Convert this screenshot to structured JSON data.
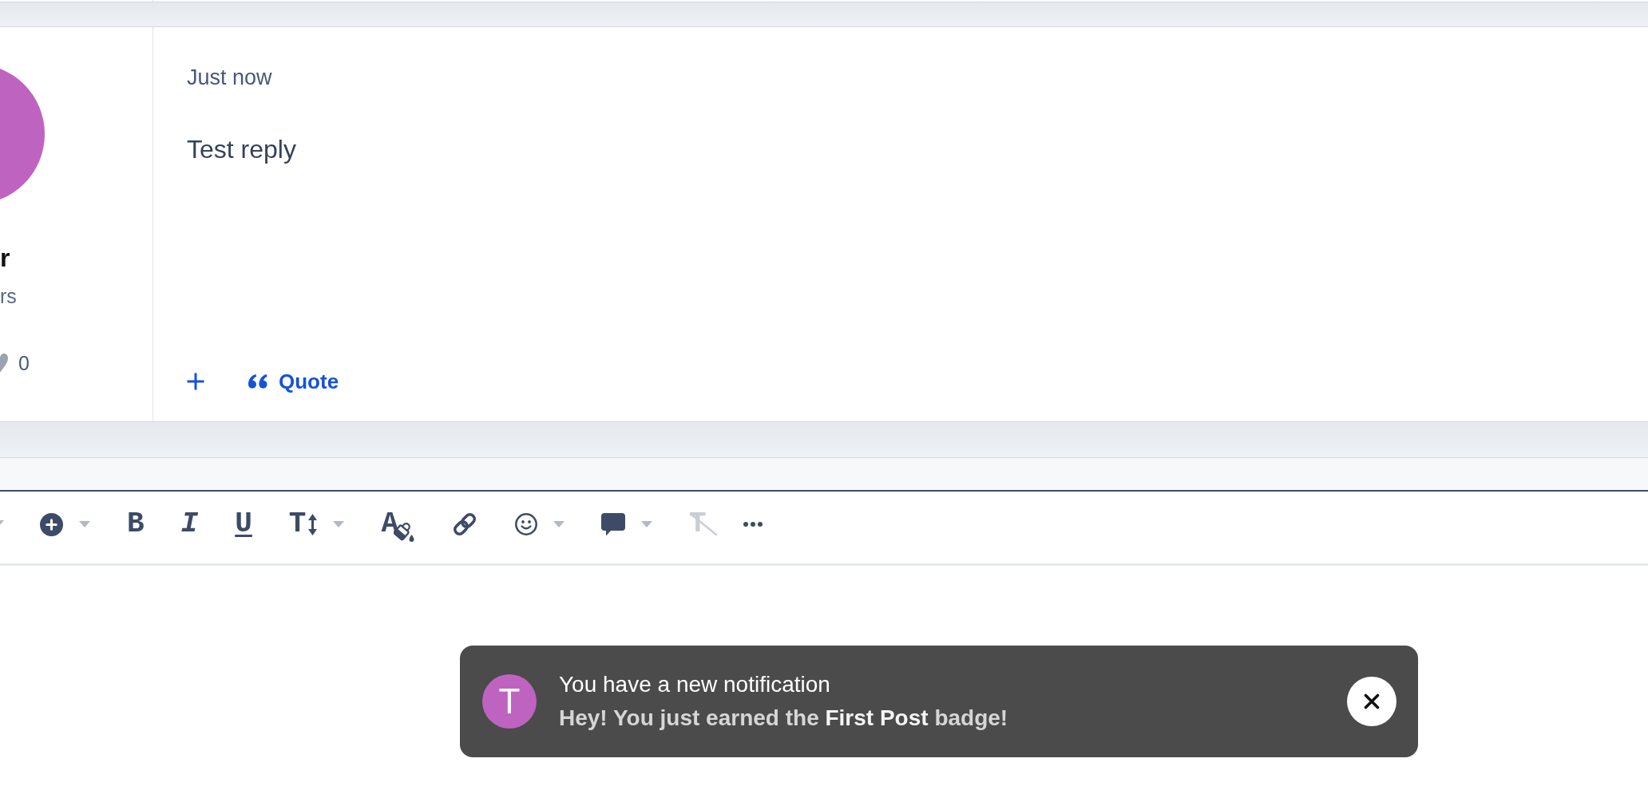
{
  "post": {
    "author": {
      "name": "r",
      "subtitle": "rs",
      "likes": "0"
    },
    "time": "Just now",
    "body": "Test reply",
    "actions": [
      {
        "kind": "add"
      },
      {
        "kind": "quote",
        "label": "Quote"
      }
    ]
  },
  "editor": {
    "toolbar": [
      {
        "kind": "insert",
        "dropdown": true,
        "disabled": false
      },
      {
        "kind": "bold",
        "glyph": "B",
        "dropdown": false,
        "disabled": false
      },
      {
        "kind": "italic",
        "glyph": "I",
        "dropdown": false,
        "disabled": false
      },
      {
        "kind": "underline",
        "glyph": "U",
        "dropdown": false,
        "disabled": false
      },
      {
        "kind": "font_size",
        "glyph": "T",
        "dropdown": true,
        "disabled": false
      },
      {
        "kind": "text_color",
        "glyph": "A",
        "dropdown": false,
        "disabled": false
      },
      {
        "kind": "link",
        "dropdown": false,
        "disabled": false
      },
      {
        "kind": "emoji",
        "dropdown": true,
        "disabled": false
      },
      {
        "kind": "comment",
        "dropdown": true,
        "disabled": false
      },
      {
        "kind": "clear_format",
        "glyph": "T",
        "dropdown": false,
        "disabled": true
      },
      {
        "kind": "more",
        "dropdown": false,
        "disabled": false
      }
    ]
  },
  "notification": {
    "avatar_letter": "T",
    "title": "You have a new notification",
    "message": "Hey! You just earned the **First Post** badge!"
  }
}
